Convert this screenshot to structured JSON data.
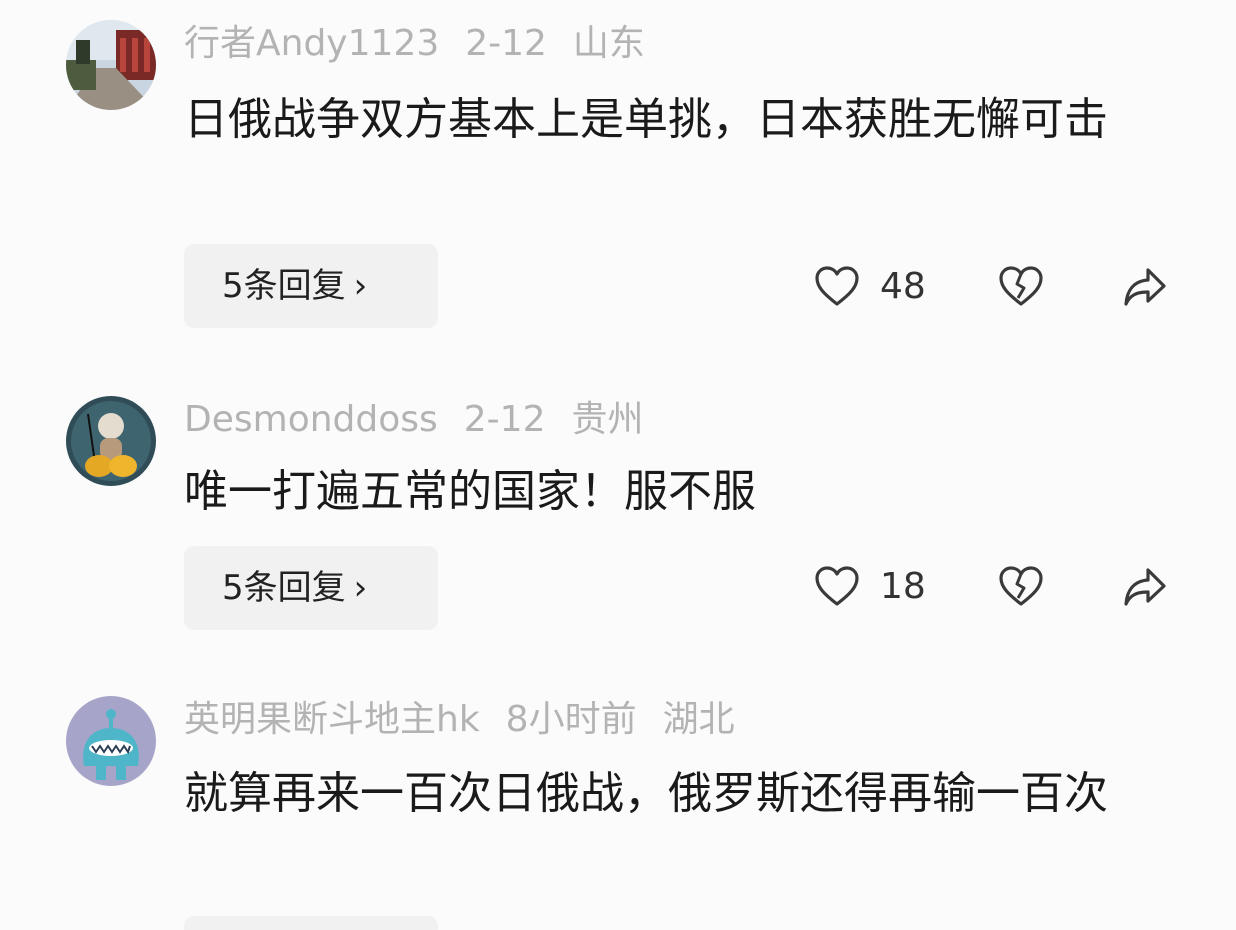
{
  "comments": [
    {
      "username": "行者Andy1123",
      "date": "2-12",
      "location": "山东",
      "text": "日俄战争双方基本上是单挑，日本获胜无懈可击",
      "replies_label": "5条回复",
      "likes": "48",
      "avatar_icon": "avatar-photo-street"
    },
    {
      "username": "Desmonddoss",
      "date": "2-12",
      "location": "贵州",
      "text": "唯一打遍五常的国家！服不服",
      "replies_label": "5条回复",
      "likes": "18",
      "avatar_icon": "avatar-monk-figure"
    },
    {
      "username": "英明果断斗地主hk",
      "date": "8小时前",
      "location": "湖北",
      "text": "就算再来一百次日俄战，俄罗斯还得再输一百次",
      "avatar_icon": "avatar-cartoon-monster"
    }
  ],
  "icons": {
    "like": "heart-icon",
    "dislike": "broken-heart-icon",
    "share": "share-arrow-icon",
    "chevron": "chevron-right-icon"
  },
  "colors": {
    "background": "#fbfbfb",
    "meta_text": "#b3b3b3",
    "body_text": "#1a1a1a",
    "button_bg": "#f1f1f1"
  }
}
